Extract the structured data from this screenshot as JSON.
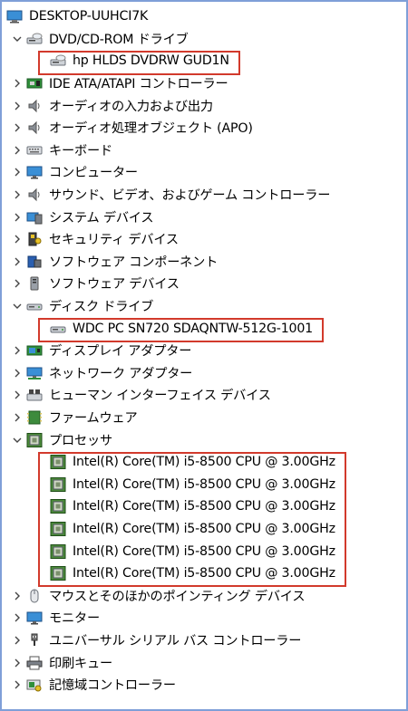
{
  "computer_name": "DESKTOP-UUHCI7K",
  "nodes": [
    {
      "label": "DVD/CD-ROM ドライブ",
      "icon": "dvd-drive-icon",
      "expanded": true,
      "children": [
        {
          "label": "hp HLDS DVDRW  GUD1N",
          "icon": "dvd-drive-icon"
        }
      ]
    },
    {
      "label": "IDE ATA/ATAPI コントローラー",
      "icon": "ide-controller-icon"
    },
    {
      "label": "オーディオの入力および出力",
      "icon": "speaker-icon"
    },
    {
      "label": "オーディオ処理オブジェクト (APO)",
      "icon": "speaker-icon"
    },
    {
      "label": "キーボード",
      "icon": "keyboard-icon"
    },
    {
      "label": "コンピューター",
      "icon": "monitor-icon"
    },
    {
      "label": "サウンド、ビデオ、およびゲーム コントローラー",
      "icon": "speaker-icon"
    },
    {
      "label": "システム デバイス",
      "icon": "system-devices-icon"
    },
    {
      "label": "セキュリティ デバイス",
      "icon": "security-device-icon"
    },
    {
      "label": "ソフトウェア コンポーネント",
      "icon": "software-component-icon"
    },
    {
      "label": "ソフトウェア デバイス",
      "icon": "software-device-icon"
    },
    {
      "label": "ディスク ドライブ",
      "icon": "disk-drive-icon",
      "expanded": true,
      "children": [
        {
          "label": "WDC PC SN720 SDAQNTW-512G-1001",
          "icon": "disk-drive-icon"
        }
      ]
    },
    {
      "label": "ディスプレイ アダプター",
      "icon": "display-adapter-icon"
    },
    {
      "label": "ネットワーク アダプター",
      "icon": "network-adapter-icon"
    },
    {
      "label": "ヒューマン インターフェイス デバイス",
      "icon": "hid-icon"
    },
    {
      "label": "ファームウェア",
      "icon": "firmware-icon"
    },
    {
      "label": "プロセッサ",
      "icon": "processor-icon",
      "expanded": true,
      "children": [
        {
          "label": "Intel(R) Core(TM) i5-8500 CPU @ 3.00GHz",
          "icon": "processor-icon"
        },
        {
          "label": "Intel(R) Core(TM) i5-8500 CPU @ 3.00GHz",
          "icon": "processor-icon"
        },
        {
          "label": "Intel(R) Core(TM) i5-8500 CPU @ 3.00GHz",
          "icon": "processor-icon"
        },
        {
          "label": "Intel(R) Core(TM) i5-8500 CPU @ 3.00GHz",
          "icon": "processor-icon"
        },
        {
          "label": "Intel(R) Core(TM) i5-8500 CPU @ 3.00GHz",
          "icon": "processor-icon"
        },
        {
          "label": "Intel(R) Core(TM) i5-8500 CPU @ 3.00GHz",
          "icon": "processor-icon"
        }
      ]
    },
    {
      "label": "マウスとそのほかのポインティング デバイス",
      "icon": "mouse-icon"
    },
    {
      "label": "モニター",
      "icon": "monitor-icon"
    },
    {
      "label": "ユニバーサル シリアル バス コントローラー",
      "icon": "usb-icon"
    },
    {
      "label": "印刷キュー",
      "icon": "printer-icon"
    },
    {
      "label": "記憶域コントローラー",
      "icon": "storage-controller-icon"
    }
  ],
  "colors": {
    "highlight": "#d23a2c",
    "frame": "#7f9fd8"
  }
}
